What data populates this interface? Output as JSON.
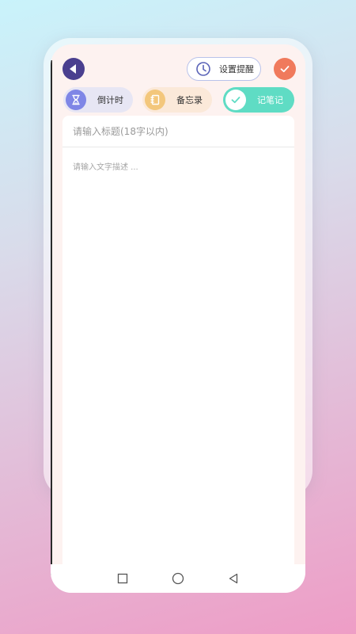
{
  "header": {
    "reminder_label": "设置提醒",
    "back_icon": "back-arrow-icon",
    "confirm_icon": "checkmark-icon"
  },
  "tabs": [
    {
      "label": "倒计时",
      "icon": "hourglass-icon",
      "active": false
    },
    {
      "label": "备忘录",
      "icon": "notebook-icon",
      "active": false
    },
    {
      "label": "记笔记",
      "icon": "checkmark-icon",
      "active": true
    }
  ],
  "form": {
    "title_placeholder": "请输入标题(18字以内)",
    "title_value": "",
    "desc_placeholder": "请输入文字描述 ...",
    "desc_value": ""
  },
  "navbar": {
    "icons": [
      "recent-apps-icon",
      "home-icon",
      "back-icon"
    ]
  },
  "colors": {
    "back_button": "#4a3f8f",
    "confirm_button": "#f07a5c",
    "active_tab": "#5fdcc4",
    "countdown_icon": "#7f86e6",
    "memo_icon": "#f3c77c"
  }
}
